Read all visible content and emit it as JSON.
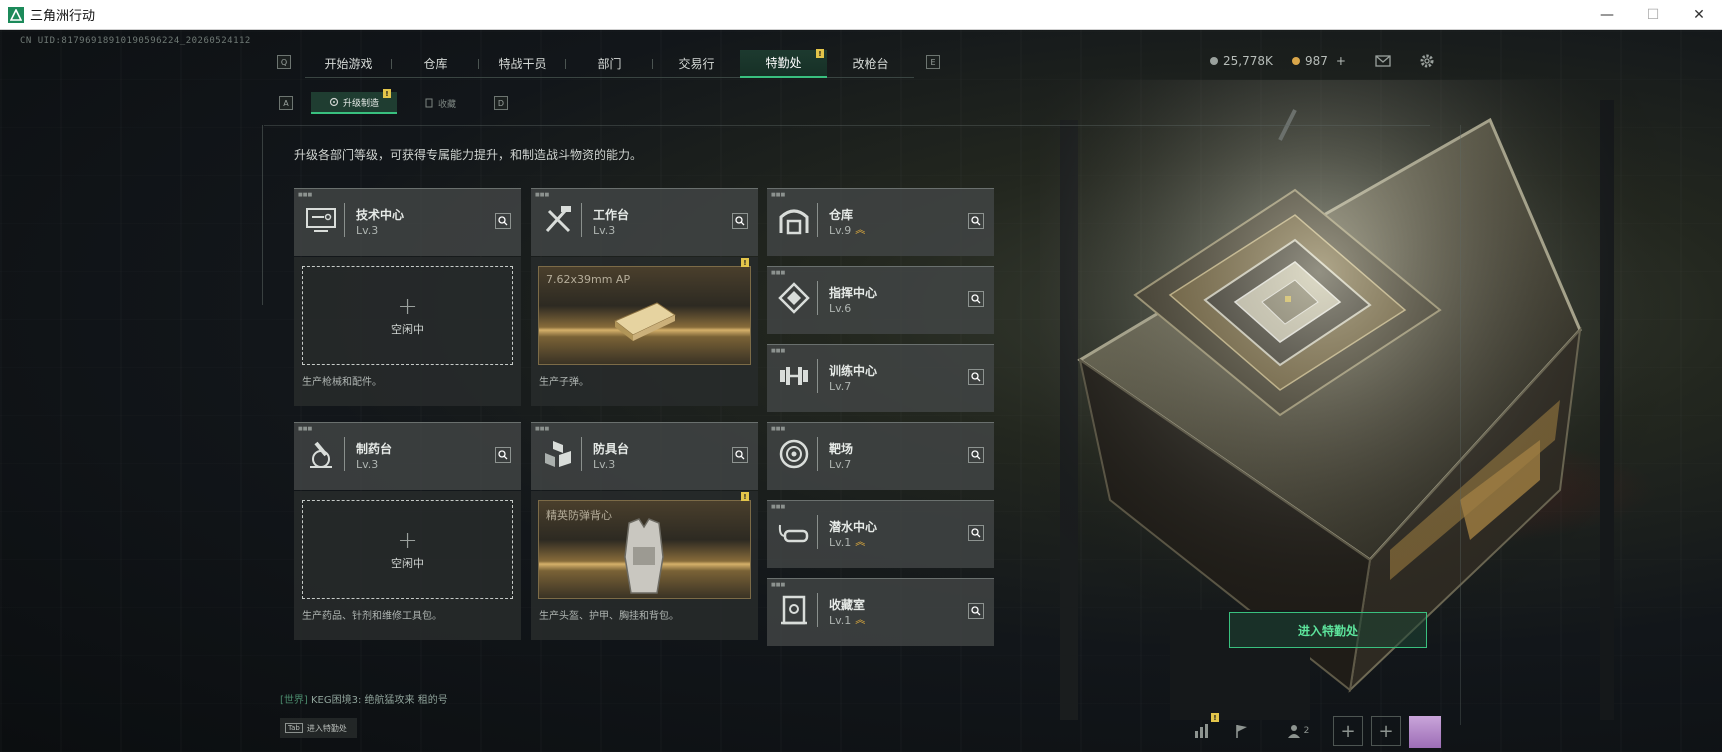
{
  "window": {
    "title": "三角洲行动",
    "minimize": "—",
    "maximize": "☐",
    "close": "✕"
  },
  "uid": "CN UID:81796918910190596224_20260524112",
  "nav": {
    "left_key": "Q",
    "right_key": "E",
    "tabs": [
      "开始游戏",
      "仓库",
      "特战干员",
      "部门",
      "交易行",
      "特勤处",
      "改枪台"
    ],
    "active": "特勤处",
    "badge": "!"
  },
  "subnav": {
    "left_key": "A",
    "right_key": "D",
    "tabs": [
      "升级制造",
      "收藏"
    ],
    "badge": "!"
  },
  "currency": {
    "coins": "25,778K",
    "premium": "987",
    "plus": "+"
  },
  "description": "升级各部门等级，可获得专属能力提升，和制造战斗物资的能力。",
  "departments": [
    {
      "name": "技术中心",
      "level": "Lv.3",
      "icon": "tech-center-icon",
      "upgradable": false
    },
    {
      "name": "工作台",
      "level": "Lv.3",
      "icon": "workbench-icon",
      "upgradable": false
    },
    {
      "name": "仓库",
      "level": "Lv.9",
      "icon": "warehouse-icon",
      "upgradable": true
    },
    {
      "name": "指挥中心",
      "level": "Lv.6",
      "icon": "command-center-icon",
      "upgradable": false
    },
    {
      "name": "训练中心",
      "level": "Lv.7",
      "icon": "training-center-icon",
      "upgradable": false
    },
    {
      "name": "制药台",
      "level": "Lv.3",
      "icon": "pharmacy-icon",
      "upgradable": false
    },
    {
      "name": "防具台",
      "level": "Lv.3",
      "icon": "armor-bench-icon",
      "upgradable": false
    },
    {
      "name": "靶场",
      "level": "Lv.7",
      "icon": "shooting-range-icon",
      "upgradable": false
    },
    {
      "name": "潜水中心",
      "level": "Lv.1",
      "icon": "diving-center-icon",
      "upgradable": true
    },
    {
      "name": "收藏室",
      "level": "Lv.1",
      "icon": "collection-room-icon",
      "upgradable": true
    }
  ],
  "production": {
    "tech": {
      "status": "空闲中",
      "desc": "生产枪械和配件。"
    },
    "workbench": {
      "item": "7.62x39mm AP",
      "desc": "生产子弹。",
      "flag": "!"
    },
    "pharmacy": {
      "status": "空闲中",
      "desc": "生产药品、针剂和维修工具包。"
    },
    "armor": {
      "item": "精英防弹背心",
      "desc": "生产头盔、护甲、胸挂和背包。",
      "flag": "!"
    }
  },
  "enter_button": "进入特勤处",
  "chat": {
    "channel": "[世界]",
    "user": "KEG困境3:",
    "message": "绝航猛攻来 租的号"
  },
  "tab_hint": {
    "key": "Tab",
    "label": "进入特勤处"
  },
  "bottom": {
    "friends_count": "2",
    "stats_badge": "!"
  },
  "colors": {
    "accent": "#39c07f",
    "upgrade": "#e8b23e",
    "badge": "#e3c54a"
  }
}
